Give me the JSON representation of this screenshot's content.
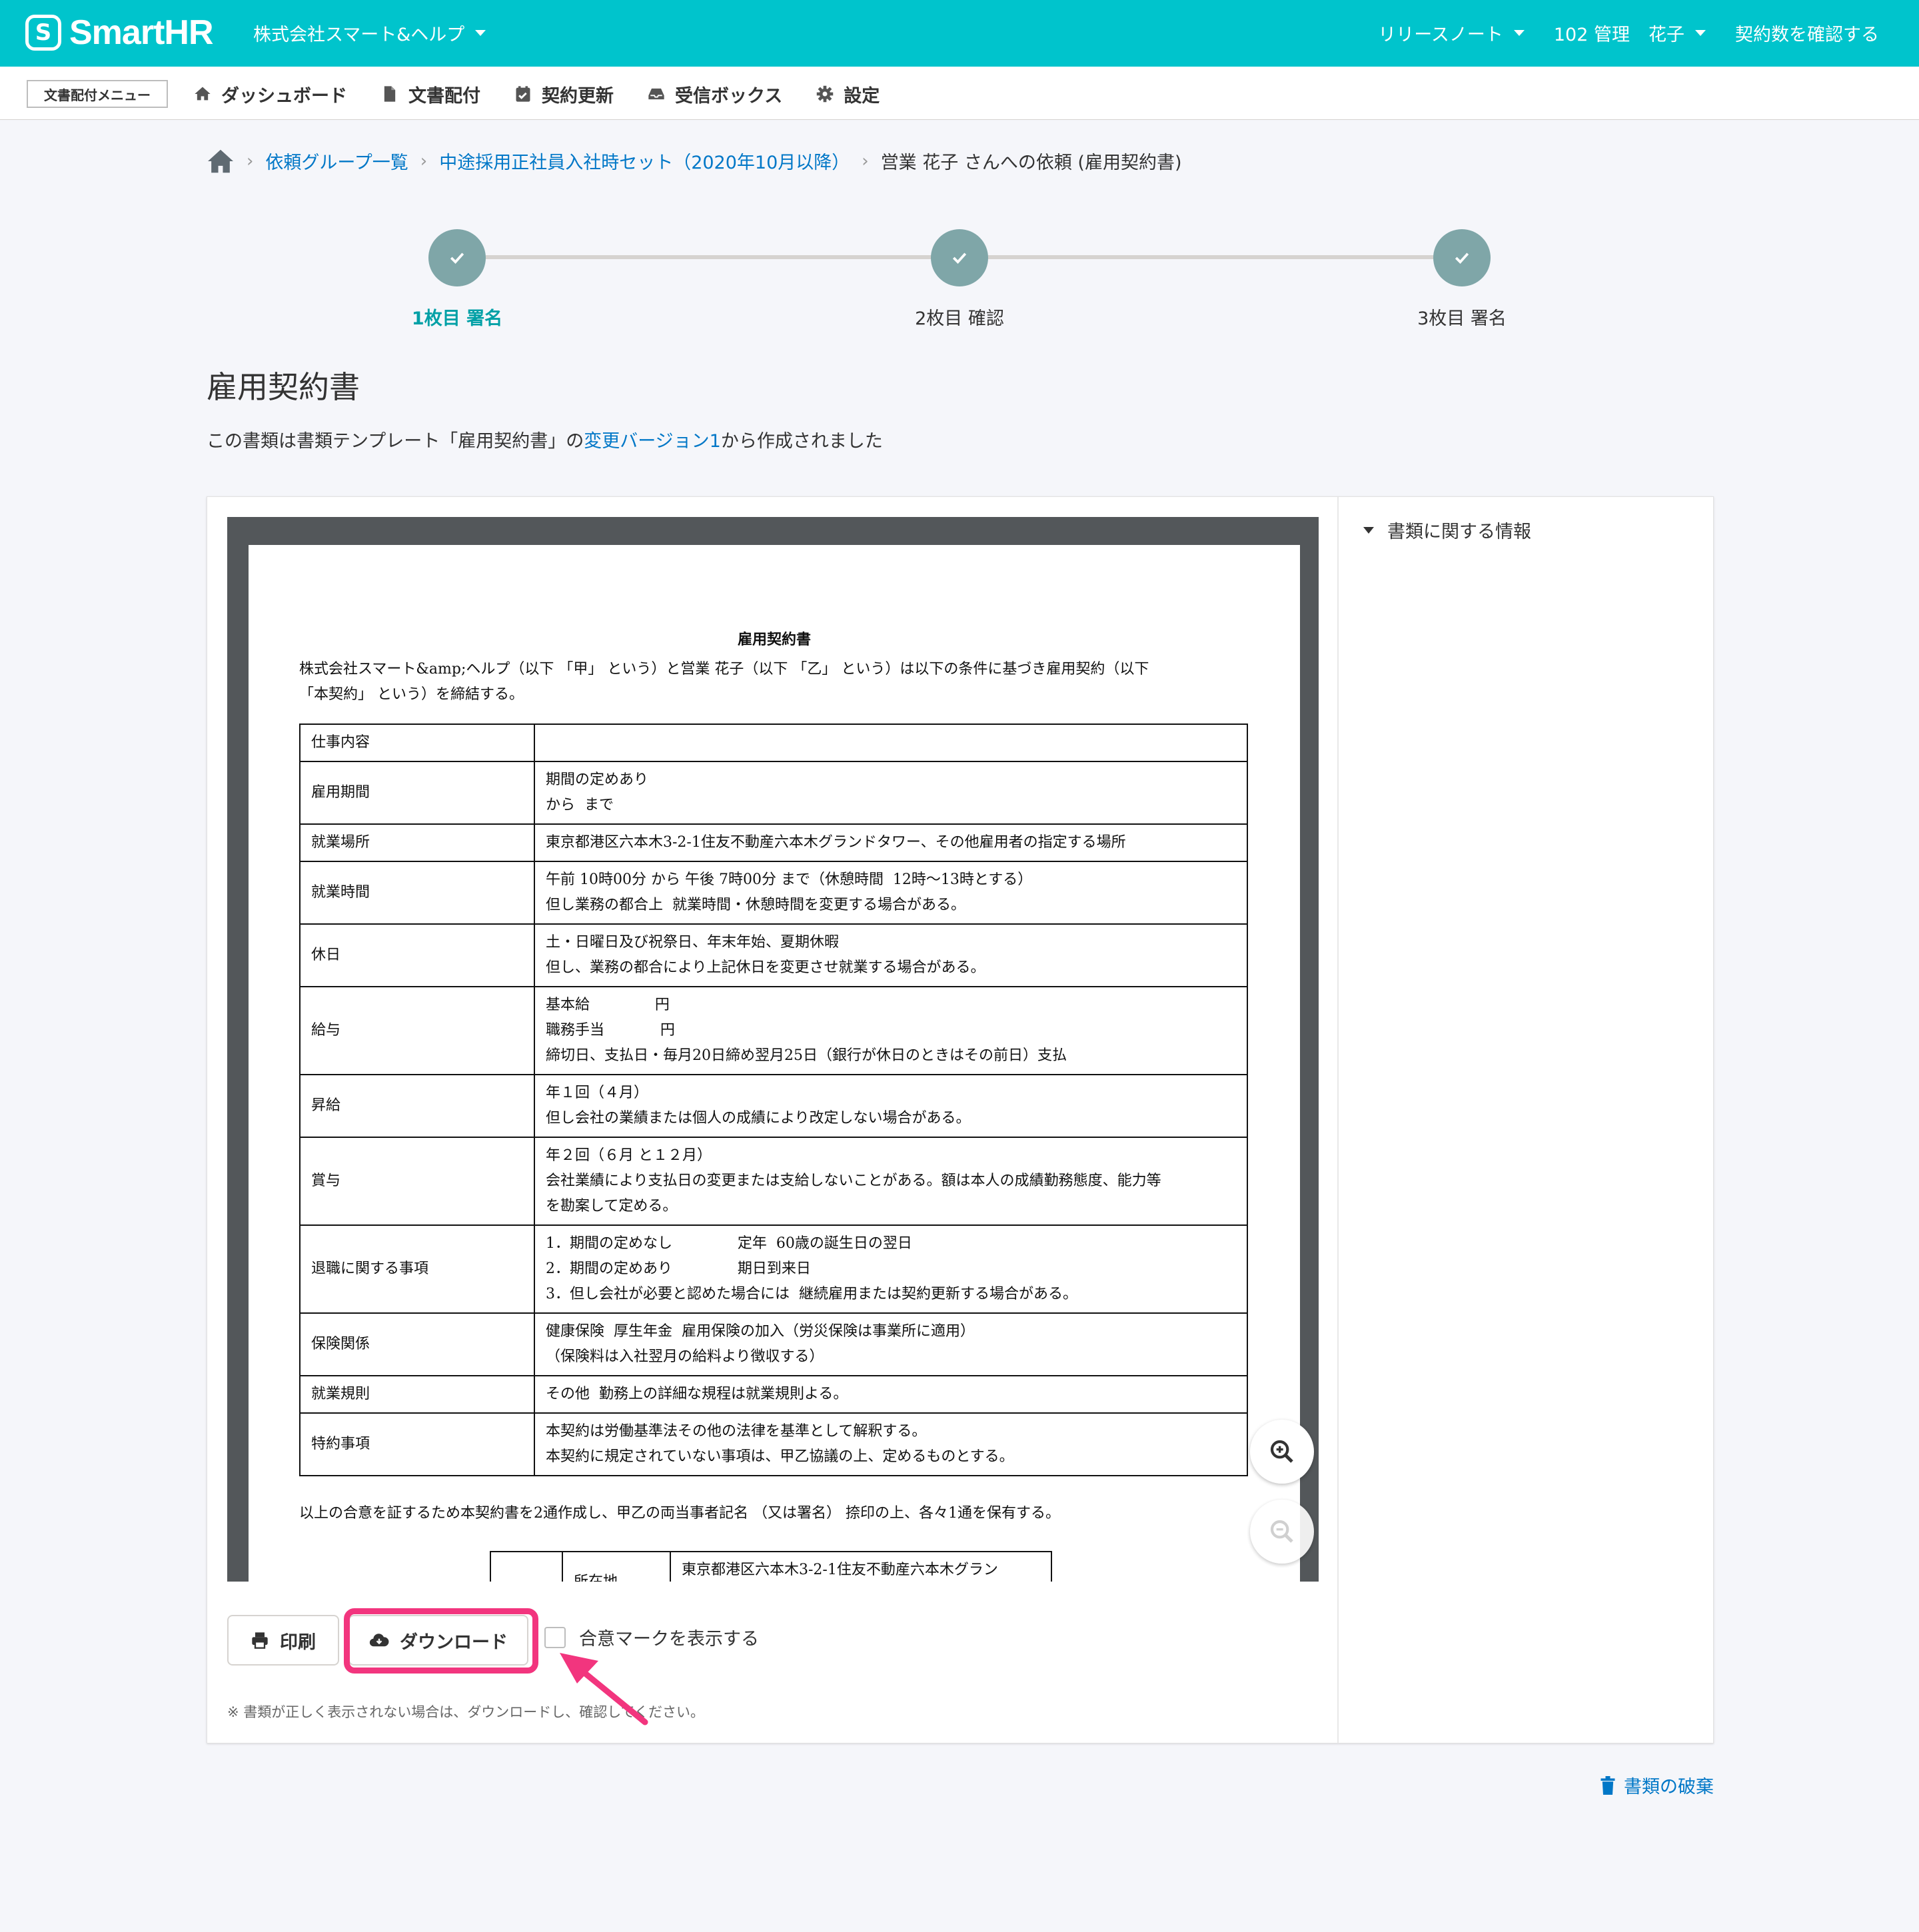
{
  "header": {
    "logo_mark": "S",
    "logo_text": "SmartHR",
    "tenant": "株式会社スマート&ヘルプ",
    "release_notes": "リリースノート",
    "user_id": "102 管理",
    "user_name": "花子",
    "contract_check": "契約数を確認する",
    "accent_color": "#00c4cc"
  },
  "subnav": {
    "label": "文書配付メニュー",
    "items": [
      {
        "label": "ダッシュボード",
        "icon": "home-icon"
      },
      {
        "label": "文書配付",
        "icon": "document-icon"
      },
      {
        "label": "契約更新",
        "icon": "calendar-check-icon"
      },
      {
        "label": "受信ボックス",
        "icon": "inbox-icon"
      },
      {
        "label": "設定",
        "icon": "gear-icon"
      }
    ]
  },
  "breadcrumb": {
    "items": [
      "依頼グループ一覧",
      "中途採用正社員入社時セット（2020年10月以降）"
    ],
    "current": "営業 花子 さんへの依頼 (雇用契約書)"
  },
  "stepper": {
    "steps": [
      {
        "label": "1枚目 署名",
        "active": true
      },
      {
        "label": "2枚目 確認",
        "active": false
      },
      {
        "label": "3枚目 署名",
        "active": false
      }
    ]
  },
  "page": {
    "title": "雇用契約書",
    "desc_prefix": "この書類は書類テンプレート「雇用契約書」の",
    "desc_link": "変更バージョン1",
    "desc_suffix": "から作成されました"
  },
  "sidebar": {
    "info_toggle": "書類に関する情報"
  },
  "document": {
    "title": "雇用契約書",
    "intro_line1": "株式会社スマート&amp;ヘルプ（以下 「甲」 という）と営業 花子（以下 「乙」 という）は以下の条件に基づき雇用契約（以下",
    "intro_line2": "「本契約」 という）を締結する。",
    "rows": [
      {
        "key": "仕事内容",
        "lines": [
          ""
        ]
      },
      {
        "key": "雇用期間",
        "lines": [
          "期間の定めあり",
          "から  まで"
        ]
      },
      {
        "key": "就業場所",
        "lines": [
          "東京都港区六本木3-2-1住友不動産六本木グランドタワー、その他雇用者の指定する場所"
        ]
      },
      {
        "key": "就業時間",
        "lines": [
          "午前 10時00分 から 午後 7時00分 まで（休憩時間  12時～13時とする）",
          "但し業務の都合上  就業時間・休憩時間を変更する場合がある。"
        ]
      },
      {
        "key": "休日",
        "lines": [
          "土・日曜日及び祝祭日、年末年始、夏期休暇",
          "但し、業務の都合により上記休日を変更させ就業する場合がある。"
        ]
      },
      {
        "key": "給与",
        "lines": [
          "基本給              円",
          "職務手当            円",
          "締切日、支払日・毎月20日締め翌月25日（銀行が休日のときはその前日）支払"
        ]
      },
      {
        "key": "昇給",
        "lines": [
          "年１回（４月）",
          "但し会社の業績または個人の成績により改定しない場合がある。"
        ]
      },
      {
        "key": "賞与",
        "lines": [
          "年２回（６月 と１２月）",
          "会社業績により支払日の変更または支給しないことがある。額は本人の成績勤務態度、能力等",
          "を勘案して定める。"
        ]
      },
      {
        "key": "退職に関する事項",
        "lines": [
          "1．期間の定めなし              定年  60歳の誕生日の翌日",
          "2．期間の定めあり              期日到来日",
          "3．但し会社が必要と認めた場合には  継続雇用または契約更新する場合がある。"
        ]
      },
      {
        "key": "保険関係",
        "lines": [
          "健康保険  厚生年金  雇用保険の加入（労災保険は事業所に適用）",
          "（保険料は入社翌月の給料より徴収する）"
        ]
      },
      {
        "key": "就業規則",
        "lines": [
          "その他  勤務上の詳細な規程は就業規則よる。"
        ]
      },
      {
        "key": "特約事項",
        "lines": [
          "本契約は労働基準法その他の法律を基準として解釈する。",
          "本契約に規定されていない事項は、甲乙協議の上、定めるものとする。"
        ]
      }
    ],
    "footer": "以上の合意を証するため本契約書を2通作成し、甲乙の両当事者記名  （又は署名）  捺印の上、各々1通を保有する。",
    "sig_label": "所在地",
    "sig_address": "東京都港区六本木3-2-1住友不動産六本木グラン"
  },
  "actions": {
    "print": "印刷",
    "download": "ダウンロード",
    "consent_mark": "合意マークを表示する",
    "note": "※ 書類が正しく表示されない場合は、ダウンロードし、確認してください。",
    "highlight_color": "#f2357e"
  },
  "discard": "書類の破棄"
}
